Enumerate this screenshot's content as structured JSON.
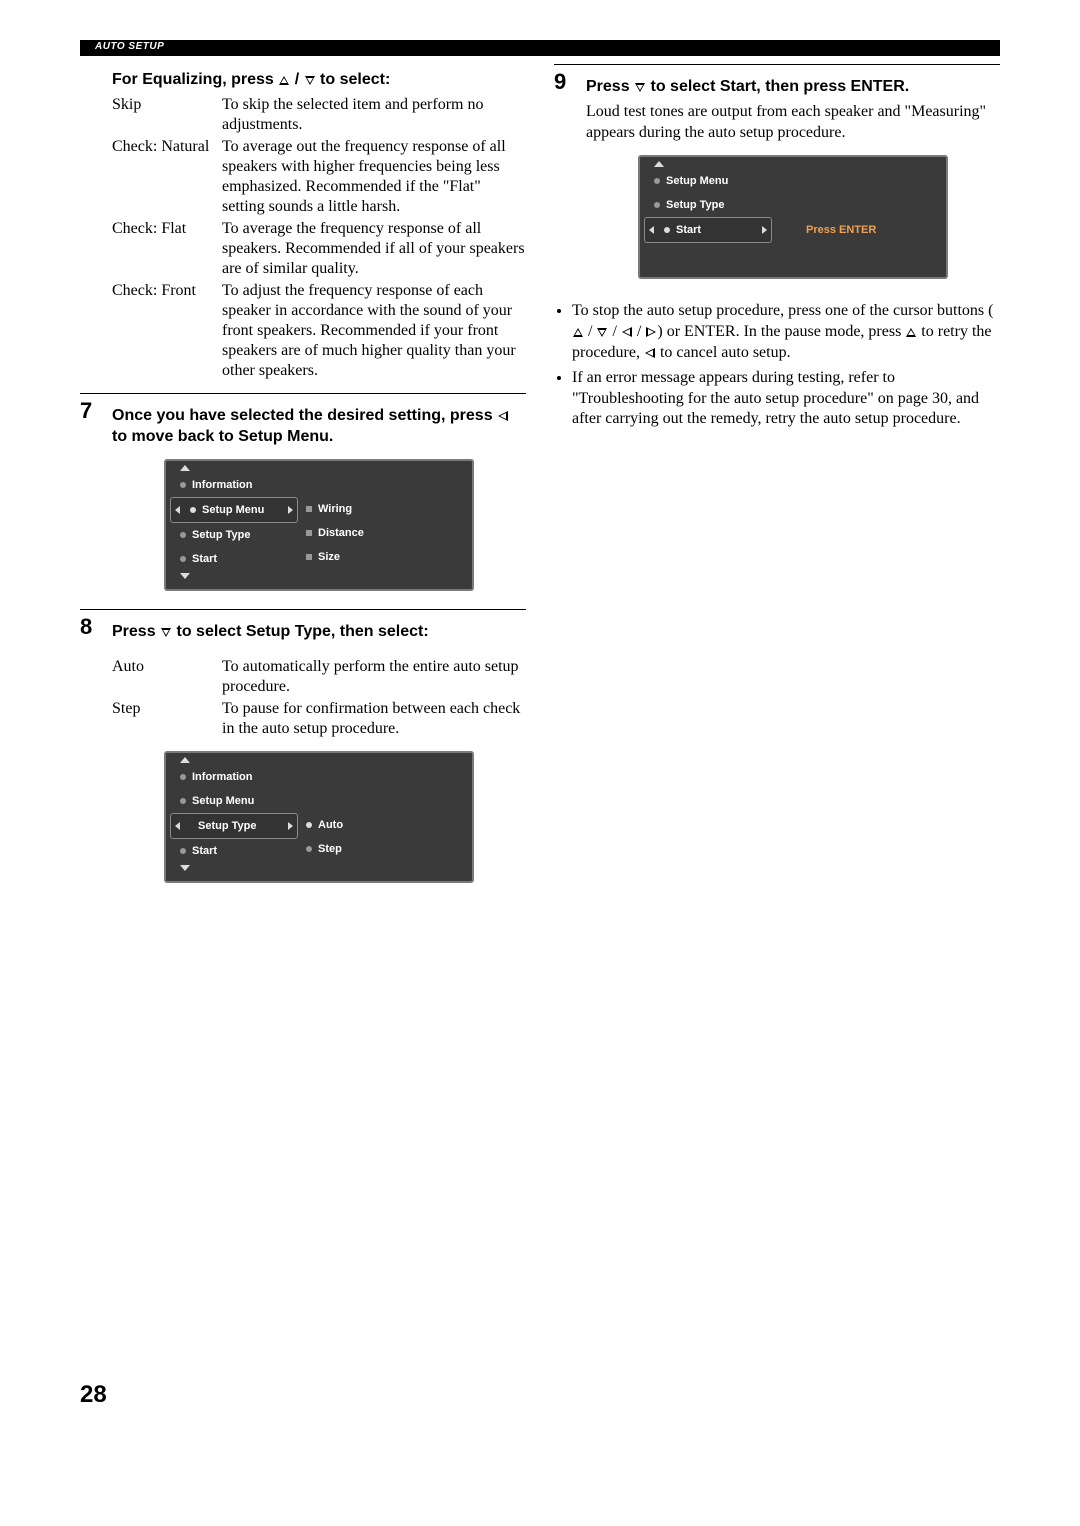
{
  "header": {
    "title": "AUTO SETUP"
  },
  "pageNumber": "28",
  "equalizing": {
    "heading": "For Equalizing, press △ / ▽ to select:",
    "options": [
      {
        "term": "Skip",
        "desc": "To skip the selected item and perform no adjustments."
      },
      {
        "term": "Check: Natural",
        "desc": "To average out the frequency response of all speakers with higher frequencies being less emphasized. Recommended if the \"Flat\" setting sounds a little harsh."
      },
      {
        "term": "Check: Flat",
        "desc": "To average the frequency response of all speakers. Recommended if all of your speakers are of similar quality."
      },
      {
        "term": "Check: Front",
        "desc": "To adjust the frequency response of each speaker in accordance with the sound of your front speakers. Recommended if your front speakers are of much higher quality than your other speakers."
      }
    ]
  },
  "step7": {
    "num": "7",
    "heading": "Once you have selected the desired setting, press ◁ to move back to Setup Menu.",
    "osd": {
      "left": [
        {
          "label": "Information"
        },
        {
          "label": "Setup Menu",
          "selected": true
        },
        {
          "label": "Setup Type"
        },
        {
          "label": "Start"
        }
      ],
      "right": [
        {
          "label": "Wiring"
        },
        {
          "label": "Distance"
        },
        {
          "label": "Size"
        }
      ]
    }
  },
  "step8": {
    "num": "8",
    "heading": "Press ▽ to select Setup Type, then select:",
    "options": [
      {
        "term": "Auto",
        "desc": "To automatically perform the entire auto setup procedure."
      },
      {
        "term": "Step",
        "desc": "To pause for confirmation between each check in the auto setup procedure."
      }
    ],
    "osd": {
      "left": [
        {
          "label": "Information"
        },
        {
          "label": "Setup Menu"
        },
        {
          "label": "Setup Type",
          "selected": true
        },
        {
          "label": "Start"
        }
      ],
      "right": [
        {
          "label": "Auto"
        },
        {
          "label": "Step"
        }
      ]
    }
  },
  "step9": {
    "num": "9",
    "heading": "Press ▽ to select Start, then press ENTER.",
    "body": "Loud test tones are output from each speaker and \"Measuring\" appears during the auto setup procedure.",
    "osd": {
      "left": [
        {
          "label": "Setup Menu"
        },
        {
          "label": "Setup Type"
        },
        {
          "label": "Start",
          "selected": true
        }
      ],
      "rightText": "Press ENTER"
    },
    "notes": [
      "To stop the auto setup procedure, press one of the cursor buttons (△ / ▽ / ◁ / ▷) or ENTER. In the pause mode, press △ to retry the procedure, ◁ to cancel auto setup.",
      "If an error message appears during testing, refer to \"Troubleshooting for the auto setup procedure\" on page 30, and after carrying out the remedy, retry the auto setup procedure."
    ]
  }
}
